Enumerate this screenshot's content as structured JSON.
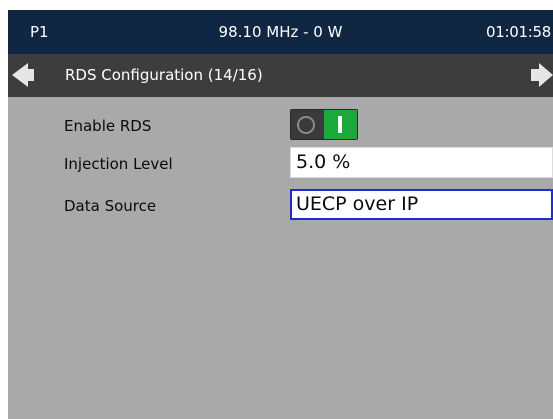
{
  "status_bar": {
    "preset": "P1",
    "frequency_power": "98.10 MHz - 0 W",
    "clock": "01:01:58"
  },
  "nav": {
    "title": "RDS Configuration (14/16)",
    "prev_icon": "triangle-left-icon",
    "next_icon": "triangle-right-icon"
  },
  "settings": {
    "enable_rds": {
      "label": "Enable RDS",
      "state": "on"
    },
    "injection_level": {
      "label": "Injection Level",
      "value": "5.0 %"
    },
    "data_source": {
      "label": "Data Source",
      "value": "UECP over IP"
    }
  },
  "colors": {
    "status_bar_bg": "#0f2743",
    "nav_bar_bg": "#3d3d3d",
    "content_bg": "#a9a9a9",
    "toggle_on": "#1aaa3a",
    "focus_border": "#1f2bd6"
  }
}
